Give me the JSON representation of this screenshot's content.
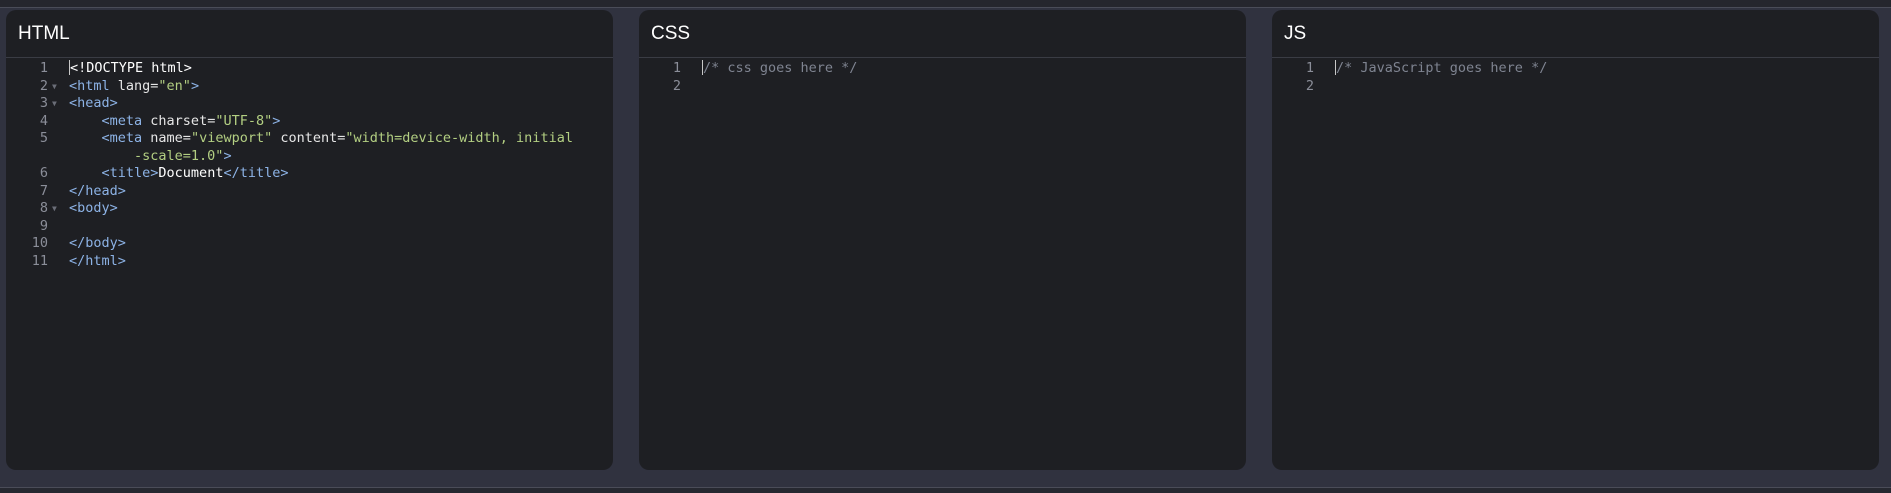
{
  "panels": {
    "html": {
      "title": "HTML",
      "lines": [
        {
          "n": "1",
          "fold": "",
          "tokens": [
            {
              "t": "cursor"
            },
            {
              "c": "t-text",
              "v": "<!DOCTYPE html>"
            }
          ]
        },
        {
          "n": "2",
          "fold": "▼",
          "tokens": [
            {
              "c": "t-tag",
              "v": "<html "
            },
            {
              "c": "t-attr",
              "v": "lang="
            },
            {
              "c": "t-str",
              "v": "\"en\""
            },
            {
              "c": "t-tag",
              "v": ">"
            }
          ]
        },
        {
          "n": "3",
          "fold": "▼",
          "tokens": [
            {
              "c": "t-tag",
              "v": "<head>"
            }
          ]
        },
        {
          "n": "4",
          "fold": "",
          "tokens": [
            {
              "c": "t-text",
              "v": "    "
            },
            {
              "c": "t-tag",
              "v": "<meta "
            },
            {
              "c": "t-attr",
              "v": "charset="
            },
            {
              "c": "t-str",
              "v": "\"UTF-8\""
            },
            {
              "c": "t-tag",
              "v": ">"
            }
          ]
        },
        {
          "n": "5",
          "fold": "",
          "tokens": [
            {
              "c": "t-text",
              "v": "    "
            },
            {
              "c": "t-tag",
              "v": "<meta "
            },
            {
              "c": "t-attr",
              "v": "name="
            },
            {
              "c": "t-str",
              "v": "\"viewport\""
            },
            {
              "c": "t-attr",
              "v": " content="
            },
            {
              "c": "t-str",
              "v": "\"width=device-width, initial"
            }
          ]
        },
        {
          "n": "",
          "fold": "",
          "tokens": [
            {
              "c": "t-text",
              "v": "        "
            },
            {
              "c": "t-str",
              "v": "-scale=1.0\""
            },
            {
              "c": "t-tag",
              "v": ">"
            }
          ]
        },
        {
          "n": "6",
          "fold": "",
          "tokens": [
            {
              "c": "t-text",
              "v": "    "
            },
            {
              "c": "t-tag",
              "v": "<title>"
            },
            {
              "c": "t-text",
              "v": "Document"
            },
            {
              "c": "t-tag",
              "v": "</title>"
            }
          ]
        },
        {
          "n": "7",
          "fold": "",
          "tokens": [
            {
              "c": "t-tag",
              "v": "</head>"
            }
          ]
        },
        {
          "n": "8",
          "fold": "▼",
          "tokens": [
            {
              "c": "t-tag",
              "v": "<body>"
            }
          ]
        },
        {
          "n": "9",
          "fold": "",
          "tokens": []
        },
        {
          "n": "10",
          "fold": "",
          "tokens": [
            {
              "c": "t-tag",
              "v": "</body>"
            }
          ]
        },
        {
          "n": "11",
          "fold": "",
          "tokens": [
            {
              "c": "t-tag",
              "v": "</html>"
            }
          ]
        }
      ]
    },
    "css": {
      "title": "CSS",
      "lines": [
        {
          "n": "1",
          "fold": "",
          "tokens": [
            {
              "t": "cursor"
            },
            {
              "c": "t-comment",
              "v": "/* css goes here */"
            }
          ]
        },
        {
          "n": "2",
          "fold": "",
          "tokens": []
        }
      ]
    },
    "js": {
      "title": "JS",
      "lines": [
        {
          "n": "1",
          "fold": "",
          "tokens": [
            {
              "t": "cursor"
            },
            {
              "c": "t-comment",
              "v": "/* JavaScript goes here */"
            }
          ]
        },
        {
          "n": "2",
          "fold": "",
          "tokens": []
        }
      ]
    }
  }
}
